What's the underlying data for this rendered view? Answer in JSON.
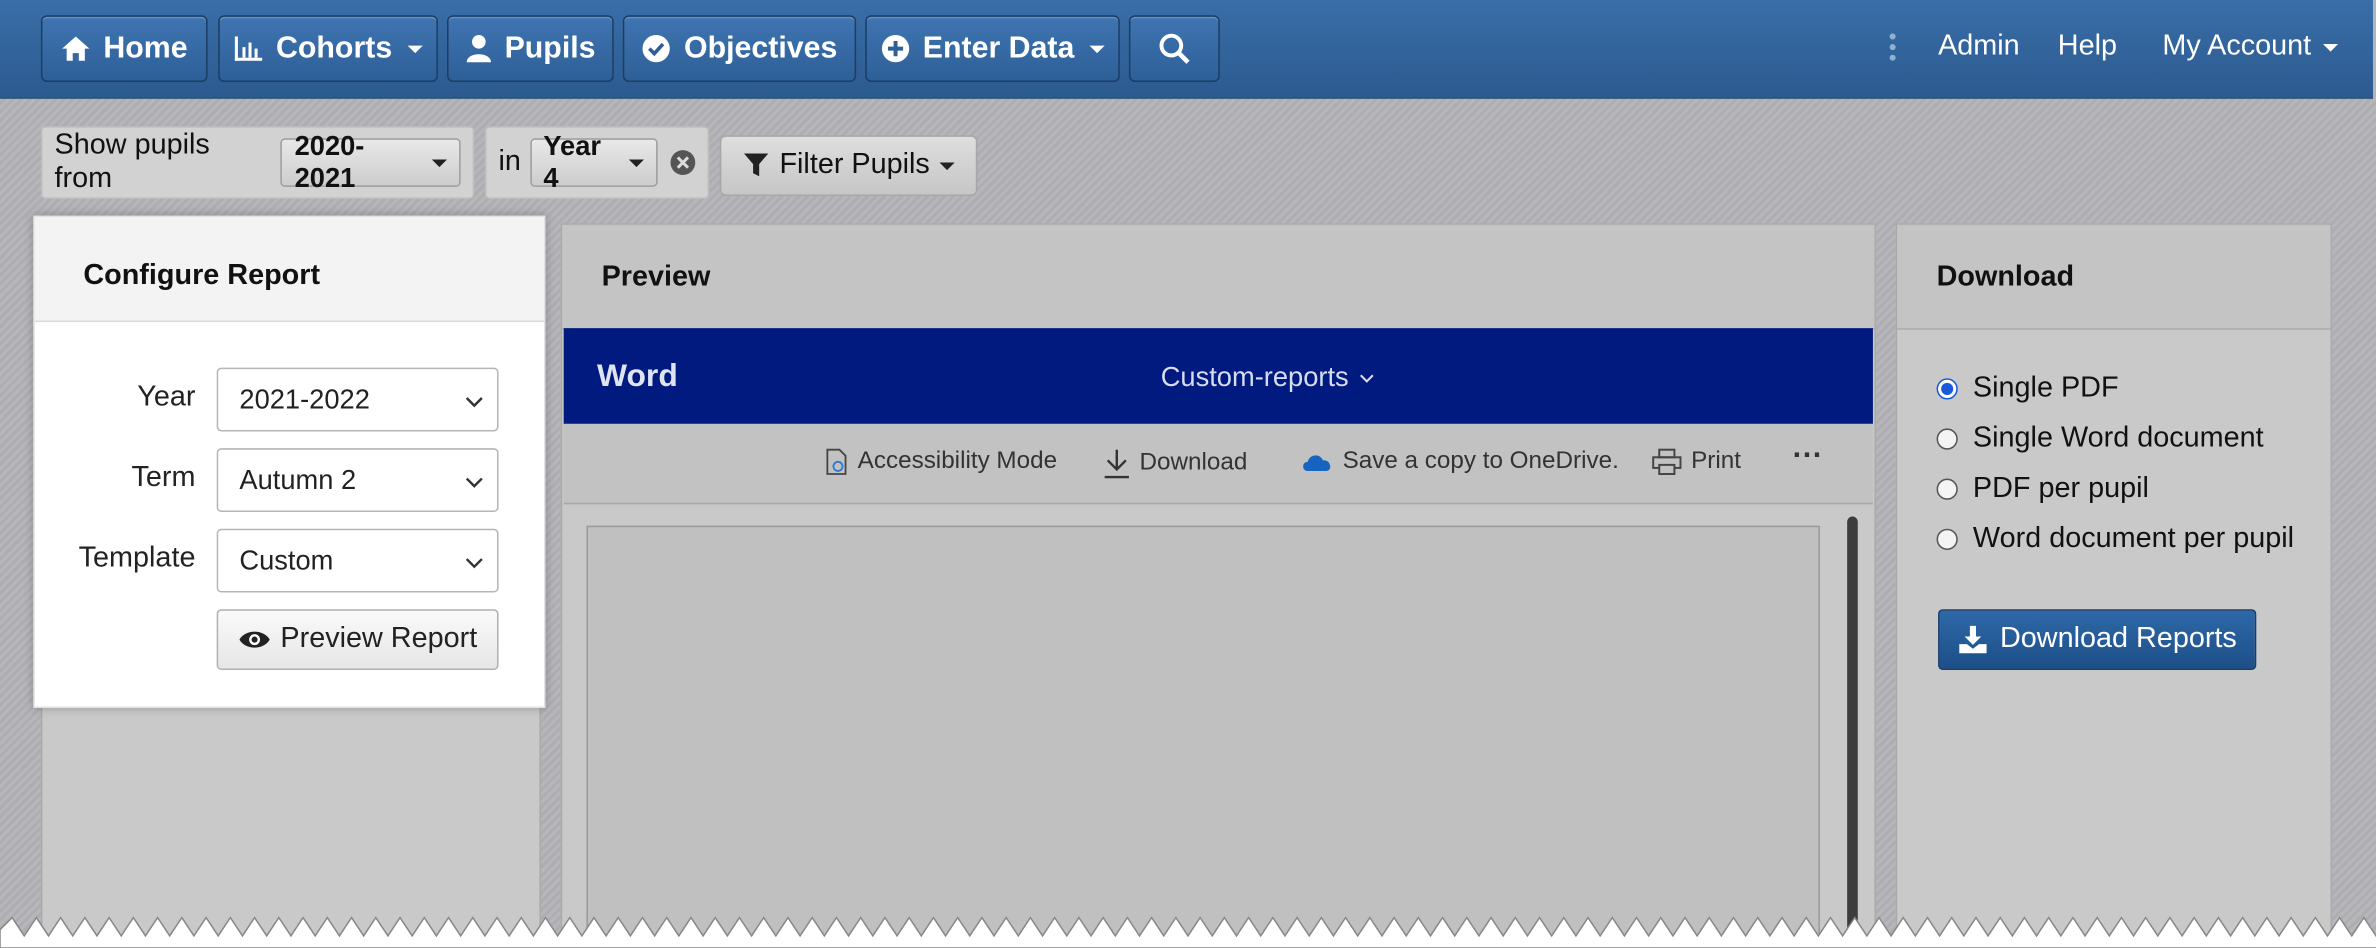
{
  "navbar": {
    "home": "Home",
    "cohorts": "Cohorts",
    "pupils": "Pupils",
    "objectives": "Objectives",
    "enter_data": "Enter Data",
    "admin": "Admin",
    "help": "Help",
    "my_account": "My Account"
  },
  "filter_bar": {
    "show_pupils_from": "Show pupils from",
    "year_value": "2020-2021",
    "in_label": "in",
    "group_value": "Year 4",
    "filter_button": "Filter Pupils"
  },
  "configure_report": {
    "title": "Configure Report",
    "year_label": "Year",
    "year_value": "2021-2022",
    "term_label": "Term",
    "term_value": "Autumn 2",
    "template_label": "Template",
    "template_value": "Custom",
    "preview_button": "Preview Report"
  },
  "preview": {
    "title": "Preview",
    "brand": "Word",
    "document_name": "Custom-reports",
    "toolbar": {
      "accessibility": "Accessibility Mode",
      "download": "Download",
      "onedrive": "Save a copy to OneDrive.",
      "print": "Print",
      "more": "···"
    }
  },
  "download": {
    "title": "Download",
    "options": [
      "Single PDF",
      "Single Word document",
      "PDF per pupil",
      "Word document per pupil"
    ],
    "selected": "Single PDF",
    "button": "Download Reports"
  },
  "colors": {
    "navbar": "#2e5f97",
    "word_bar": "#001a80",
    "primary_button": "#1d4f88",
    "radio_selected": "#1a5ad8"
  },
  "icons": [
    "home-icon",
    "chart-icon",
    "user-icon",
    "check-circle-icon",
    "plus-circle-icon",
    "search-icon",
    "close-circle-icon",
    "filter-icon",
    "chevron-down-icon",
    "eye-icon",
    "accessibility-icon",
    "download-icon",
    "onedrive-icon",
    "print-icon",
    "ellipsis-icon",
    "download-tray-icon"
  ]
}
